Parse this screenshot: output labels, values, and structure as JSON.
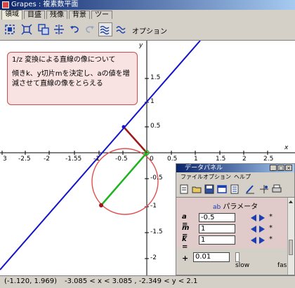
{
  "window": {
    "title": "Grapes : 複素数平面"
  },
  "tabs": [
    {
      "label": "領域",
      "active": true
    },
    {
      "label": "目盛",
      "active": false
    },
    {
      "label": "残像",
      "active": false
    },
    {
      "label": "背景",
      "active": false
    },
    {
      "label": "ツール",
      "active": false
    }
  ],
  "toolbar": {
    "option_label": "オプション",
    "icons": [
      "zoom-in-icon",
      "zoom-out-icon",
      "zoom-window-icon",
      "axis-fit-icon",
      "undo-icon",
      "redo-icon",
      "trace-icon",
      "animate-icon"
    ]
  },
  "graph": {
    "x_ticks": [
      "3",
      "-2.5",
      "-2",
      "-1.55",
      "-1",
      "-0.5",
      "0.5",
      "1",
      "1.5",
      "2",
      "2.5"
    ],
    "y_ticks": [
      "1.5",
      "1",
      "0.5",
      "-0.5",
      "-1",
      "-1.5",
      "-2"
    ],
    "axis_x_label": "x",
    "axis_y_label": "y",
    "origin_label": "0",
    "line_color": "#1414c8",
    "circle_color": "#e05050",
    "segment_green_color": "#1fb41f",
    "segment_red_color": "#a01818"
  },
  "note": {
    "title": "1/z 変換による直線の像について",
    "body": "傾きk、y切片mを決定し、aの値を増減させて直線の像をとらえる"
  },
  "panel": {
    "title": "データパネル",
    "menu": [
      "ファイル",
      "オプション",
      "ヘルプ"
    ],
    "param_header": "パラメータ",
    "params": [
      {
        "name": "a",
        "value": "-0.5"
      },
      {
        "name": "m",
        "value": "1"
      },
      {
        "name": "k",
        "value": "1"
      }
    ],
    "step_value": "0.01",
    "slow_label": "slow",
    "fast_label": "fas"
  },
  "status": {
    "cursor": "(-1.120, 1.969)",
    "range": "-3.085 < x < 3.085 , -2.349 < y < 2.1"
  }
}
